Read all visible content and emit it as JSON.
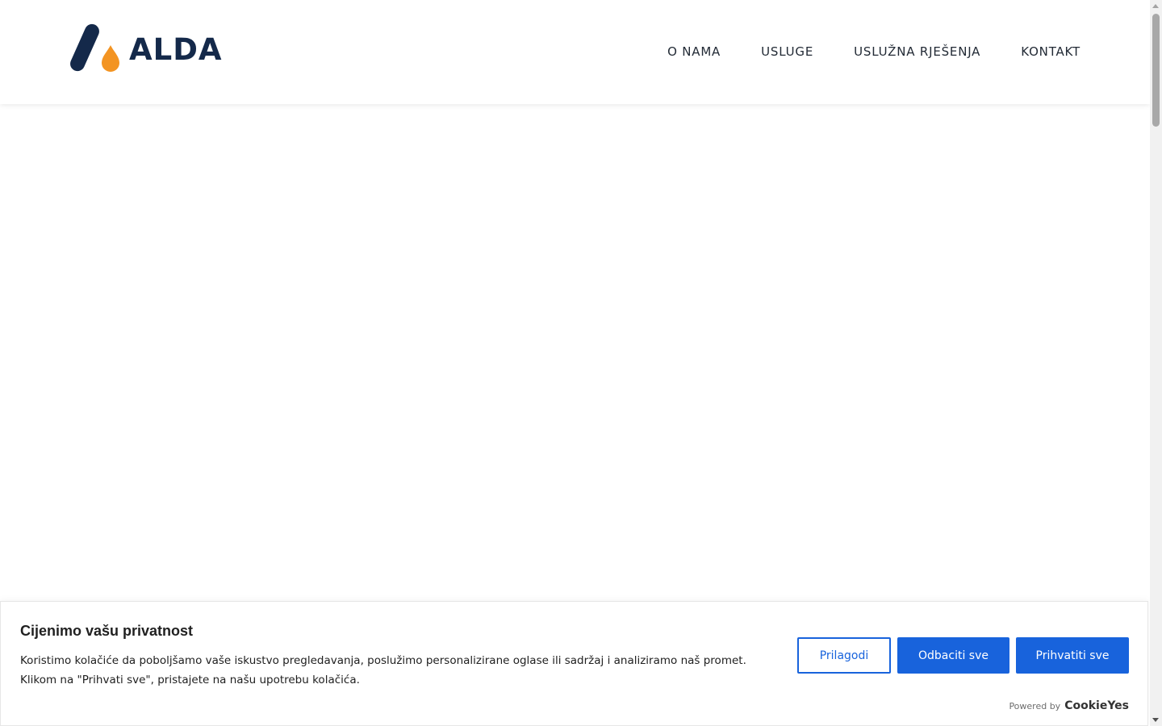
{
  "brand": {
    "name": "ALDA",
    "colors": {
      "primary": "#14294a",
      "accent": "#f39422"
    }
  },
  "nav": {
    "items": [
      {
        "label": "O NAMA"
      },
      {
        "label": "USLUGE"
      },
      {
        "label": "USLUŽNA RJEŠENJA"
      },
      {
        "label": "KONTAKT"
      }
    ]
  },
  "cookie_banner": {
    "title": "Cijenimo vašu privatnost",
    "text": "Koristimo kolačiće da poboljšamo vaše iskustvo pregledavanja, poslužimo personalizirane oglase ili sadržaj i analiziramo naš promet. Klikom na \"Prihvati sve\", pristajete na našu upotrebu kolačića.",
    "customize_label": "Prilagodi",
    "reject_label": "Odbaciti sve",
    "accept_label": "Prihvatiti sve",
    "powered_by_label": "Powered by",
    "powered_by_brand": "CookieYes",
    "accent_color": "#1863dc"
  }
}
